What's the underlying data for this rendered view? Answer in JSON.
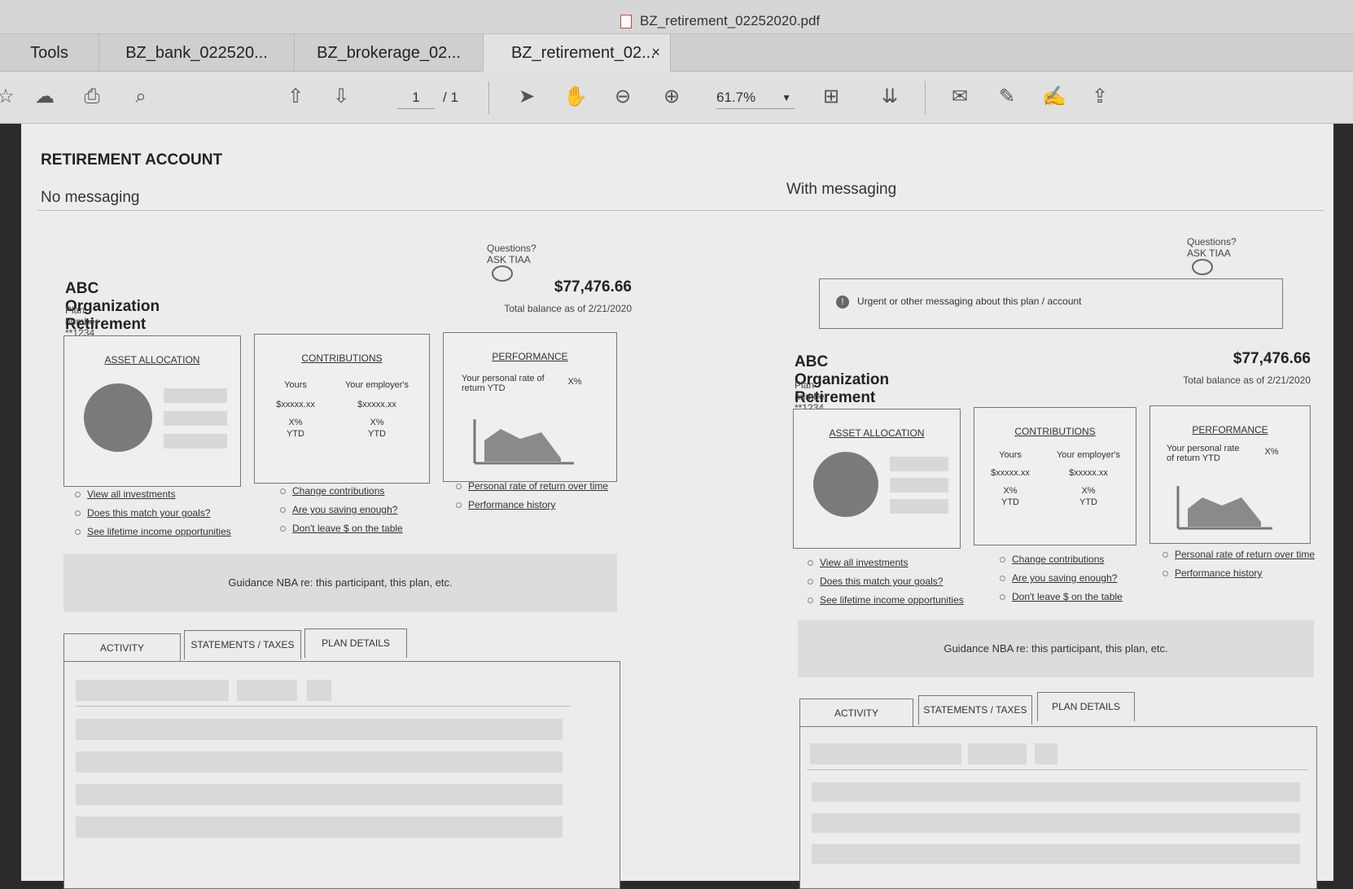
{
  "window": {
    "document_title": "BZ_retirement_02252020.pdf"
  },
  "tabs": [
    {
      "label": "Tools"
    },
    {
      "label": "BZ_bank_022520..."
    },
    {
      "label": "BZ_brokerage_02..."
    },
    {
      "label": "BZ_retirement_02...",
      "close": "×"
    }
  ],
  "toolbar": {
    "page_current": "1",
    "page_total": "/ 1",
    "zoom": "61.7%"
  },
  "doc": {
    "heading": "RETIREMENT ACCOUNT",
    "left_label": "No messaging",
    "right_label": "With messaging",
    "ask": "Questions? ASK TIAA",
    "plan_name": "ABC Organization Retirement Account Plan",
    "plan_number": "Plan number **1234",
    "balance": "$77,476.66",
    "balance_date": "Total balance as of 2/21/2020",
    "urgent": "Urgent or other messaging about this plan / account",
    "cards": {
      "asset": "ASSET ALLOCATION",
      "contrib": "CONTRIBUTIONS",
      "perf": "PERFORMANCE",
      "yours": "Yours",
      "employer": "Your employer's",
      "amount": "$xxxxx.xx",
      "pct": "X%",
      "ytd": "YTD",
      "rate": "Your personal rate of return YTD",
      "rate_pct": "X%"
    },
    "links": {
      "asset": [
        "View all investments",
        "Does this match your goals?",
        "See lifetime income opportunities"
      ],
      "contrib": [
        "Change contributions",
        "Are you saving enough?",
        "Don't leave $ on the table"
      ],
      "perf": [
        "Personal rate of return over time",
        "Performance history"
      ]
    },
    "guidance": "Guidance NBA re: this participant, this plan, etc.",
    "panel_tabs": [
      "ACTIVITY",
      "STATEMENTS / TAXES",
      "PLAN DETAILS"
    ]
  }
}
